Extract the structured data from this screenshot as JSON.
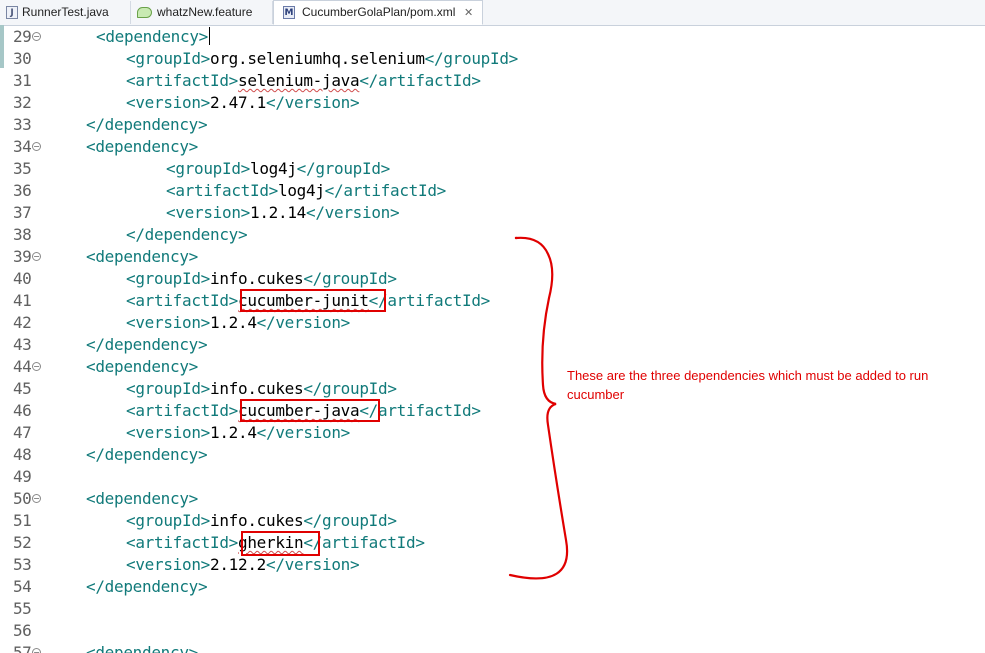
{
  "tabs": [
    {
      "label": "RunnerTest.java",
      "icon": "java-file-icon",
      "active": false
    },
    {
      "label": "whatzNew.feature",
      "icon": "feature-file-icon",
      "active": false
    },
    {
      "label": "CucumberGolaPlan/pom.xml",
      "icon": "maven-pom-icon",
      "active": true,
      "close": "✕"
    }
  ],
  "colors": {
    "tag": "#117a7a",
    "text": "#000000",
    "line_number": "#606060",
    "annotation": "#e00000"
  },
  "lines": [
    {
      "n": "29",
      "fold": true,
      "parts": [
        {
          "t": "<dependency>",
          "c": "tag"
        }
      ],
      "caret": true
    },
    {
      "n": "30",
      "fold": false,
      "parts": [
        {
          "t": "<groupId>",
          "c": "tag"
        },
        {
          "t": "org.seleniumhq.selenium",
          "c": "txt"
        },
        {
          "t": "</groupId>",
          "c": "tag"
        }
      ]
    },
    {
      "n": "31",
      "fold": false,
      "parts": [
        {
          "t": "<artifactId>",
          "c": "tag"
        },
        {
          "t": "selenium-java",
          "c": "txt",
          "squiggle": true
        },
        {
          "t": "</artifactId>",
          "c": "tag"
        }
      ]
    },
    {
      "n": "32",
      "fold": false,
      "parts": [
        {
          "t": "<version>",
          "c": "tag"
        },
        {
          "t": "2.47.1",
          "c": "txt"
        },
        {
          "t": "</version>",
          "c": "tag"
        }
      ]
    },
    {
      "n": "33",
      "fold": false,
      "parts": [
        {
          "t": "</dependency>",
          "c": "tag"
        }
      ]
    },
    {
      "n": "34",
      "fold": true,
      "parts": [
        {
          "t": "<dependency>",
          "c": "tag"
        }
      ]
    },
    {
      "n": "35",
      "fold": false,
      "parts": [
        {
          "t": "<groupId>",
          "c": "tag"
        },
        {
          "t": "log4j",
          "c": "txt"
        },
        {
          "t": "</groupId>",
          "c": "tag"
        }
      ]
    },
    {
      "n": "36",
      "fold": false,
      "parts": [
        {
          "t": "<artifactId>",
          "c": "tag"
        },
        {
          "t": "log4j",
          "c": "txt"
        },
        {
          "t": "</artifactId>",
          "c": "tag"
        }
      ]
    },
    {
      "n": "37",
      "fold": false,
      "parts": [
        {
          "t": "<version>",
          "c": "tag"
        },
        {
          "t": "1.2.14",
          "c": "txt"
        },
        {
          "t": "</version>",
          "c": "tag"
        }
      ]
    },
    {
      "n": "38",
      "fold": false,
      "parts": [
        {
          "t": "</dependency>",
          "c": "tag"
        }
      ]
    },
    {
      "n": "39",
      "fold": true,
      "parts": [
        {
          "t": "<dependency>",
          "c": "tag"
        }
      ]
    },
    {
      "n": "40",
      "fold": false,
      "parts": [
        {
          "t": "<groupId>",
          "c": "tag"
        },
        {
          "t": "info.cukes",
          "c": "txt"
        },
        {
          "t": "</groupId>",
          "c": "tag"
        }
      ]
    },
    {
      "n": "41",
      "fold": false,
      "parts": [
        {
          "t": "<artifactId>",
          "c": "tag"
        },
        {
          "t": "cucumber-junit",
          "c": "txt",
          "squiggle": true
        },
        {
          "t": "</artifactId>",
          "c": "tag"
        }
      ]
    },
    {
      "n": "42",
      "fold": false,
      "parts": [
        {
          "t": "<version>",
          "c": "tag"
        },
        {
          "t": "1.2.4",
          "c": "txt"
        },
        {
          "t": "</version>",
          "c": "tag"
        }
      ]
    },
    {
      "n": "43",
      "fold": false,
      "parts": [
        {
          "t": "</dependency>",
          "c": "tag"
        }
      ]
    },
    {
      "n": "44",
      "fold": true,
      "parts": [
        {
          "t": "<dependency>",
          "c": "tag"
        }
      ]
    },
    {
      "n": "45",
      "fold": false,
      "parts": [
        {
          "t": "<groupId>",
          "c": "tag"
        },
        {
          "t": "info.cukes",
          "c": "txt"
        },
        {
          "t": "</groupId>",
          "c": "tag"
        }
      ]
    },
    {
      "n": "46",
      "fold": false,
      "parts": [
        {
          "t": "<artifactId>",
          "c": "tag"
        },
        {
          "t": "cucumber-java",
          "c": "txt",
          "squiggle": true
        },
        {
          "t": "</artifactId>",
          "c": "tag"
        }
      ]
    },
    {
      "n": "47",
      "fold": false,
      "parts": [
        {
          "t": "<version>",
          "c": "tag"
        },
        {
          "t": "1.2.4",
          "c": "txt"
        },
        {
          "t": "</version>",
          "c": "tag"
        }
      ]
    },
    {
      "n": "48",
      "fold": false,
      "parts": [
        {
          "t": "</dependency>",
          "c": "tag"
        }
      ]
    },
    {
      "n": "49",
      "fold": false,
      "parts": []
    },
    {
      "n": "50",
      "fold": true,
      "parts": [
        {
          "t": "<dependency>",
          "c": "tag"
        }
      ]
    },
    {
      "n": "51",
      "fold": false,
      "parts": [
        {
          "t": "<groupId>",
          "c": "tag"
        },
        {
          "t": "info.cukes",
          "c": "txt"
        },
        {
          "t": "</groupId>",
          "c": "tag"
        }
      ]
    },
    {
      "n": "52",
      "fold": false,
      "parts": [
        {
          "t": "<artifactId>",
          "c": "tag"
        },
        {
          "t": "gherkin",
          "c": "txt",
          "squiggle": true
        },
        {
          "t": "</artifactId>",
          "c": "tag"
        }
      ]
    },
    {
      "n": "53",
      "fold": false,
      "parts": [
        {
          "t": "<version>",
          "c": "tag"
        },
        {
          "t": "2.12.2",
          "c": "txt"
        },
        {
          "t": "</version>",
          "c": "tag"
        }
      ]
    },
    {
      "n": "54",
      "fold": false,
      "parts": [
        {
          "t": "</dependency>",
          "c": "tag"
        }
      ]
    },
    {
      "n": "55",
      "fold": false,
      "parts": []
    },
    {
      "n": "56",
      "fold": false,
      "parts": []
    },
    {
      "n": "57",
      "fold": true,
      "parts": [
        {
          "t": "<dependency>",
          "c": "tag"
        }
      ]
    }
  ],
  "annotation": {
    "note": "These are the three dependencies which must be added to run cucumber"
  }
}
